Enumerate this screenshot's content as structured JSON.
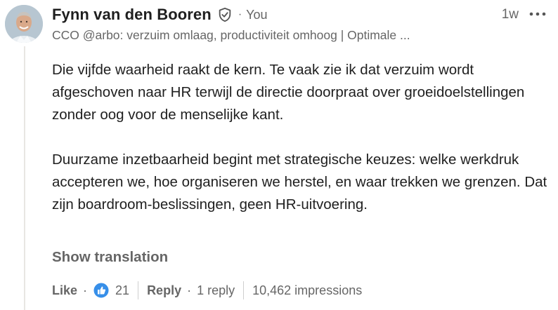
{
  "author": {
    "name": "Fynn van den Booren",
    "relation": "You",
    "headline": "CCO @arbo: verzuim omlaag, productiviteit omhoog | Optimale ...",
    "timestamp": "1w"
  },
  "icons": {
    "verified": "shield-check-icon",
    "more": "more-horizontal-icon",
    "like": "like-thumb-icon",
    "avatar": "profile-photo"
  },
  "comment": {
    "paragraphs": [
      "Die vijfde waarheid raakt de kern. Te vaak zie ik dat verzuim wordt afgeschoven naar HR terwijl de directie doorpraat over groeidoelstellingen zonder oog voor de menselijke kant.",
      "Duurzame inzetbaarheid begint met strategische keuzes: welke werkdruk accepteren we, hoe organiseren we herstel, en waar trekken we grenzen. Dat zijn boardroom-beslissingen, geen HR-uitvoering."
    ],
    "show_translation": "Show translation"
  },
  "actions": {
    "like_label": "Like",
    "reaction_count": "21",
    "reply_label": "Reply",
    "reply_count": "1 reply",
    "impressions": "10,462 impressions",
    "separator": "·"
  },
  "colors": {
    "text_primary": "#1f1f1f",
    "text_secondary": "#666666",
    "like_blue": "#378fe9",
    "thread_line": "#e8e6e3"
  }
}
